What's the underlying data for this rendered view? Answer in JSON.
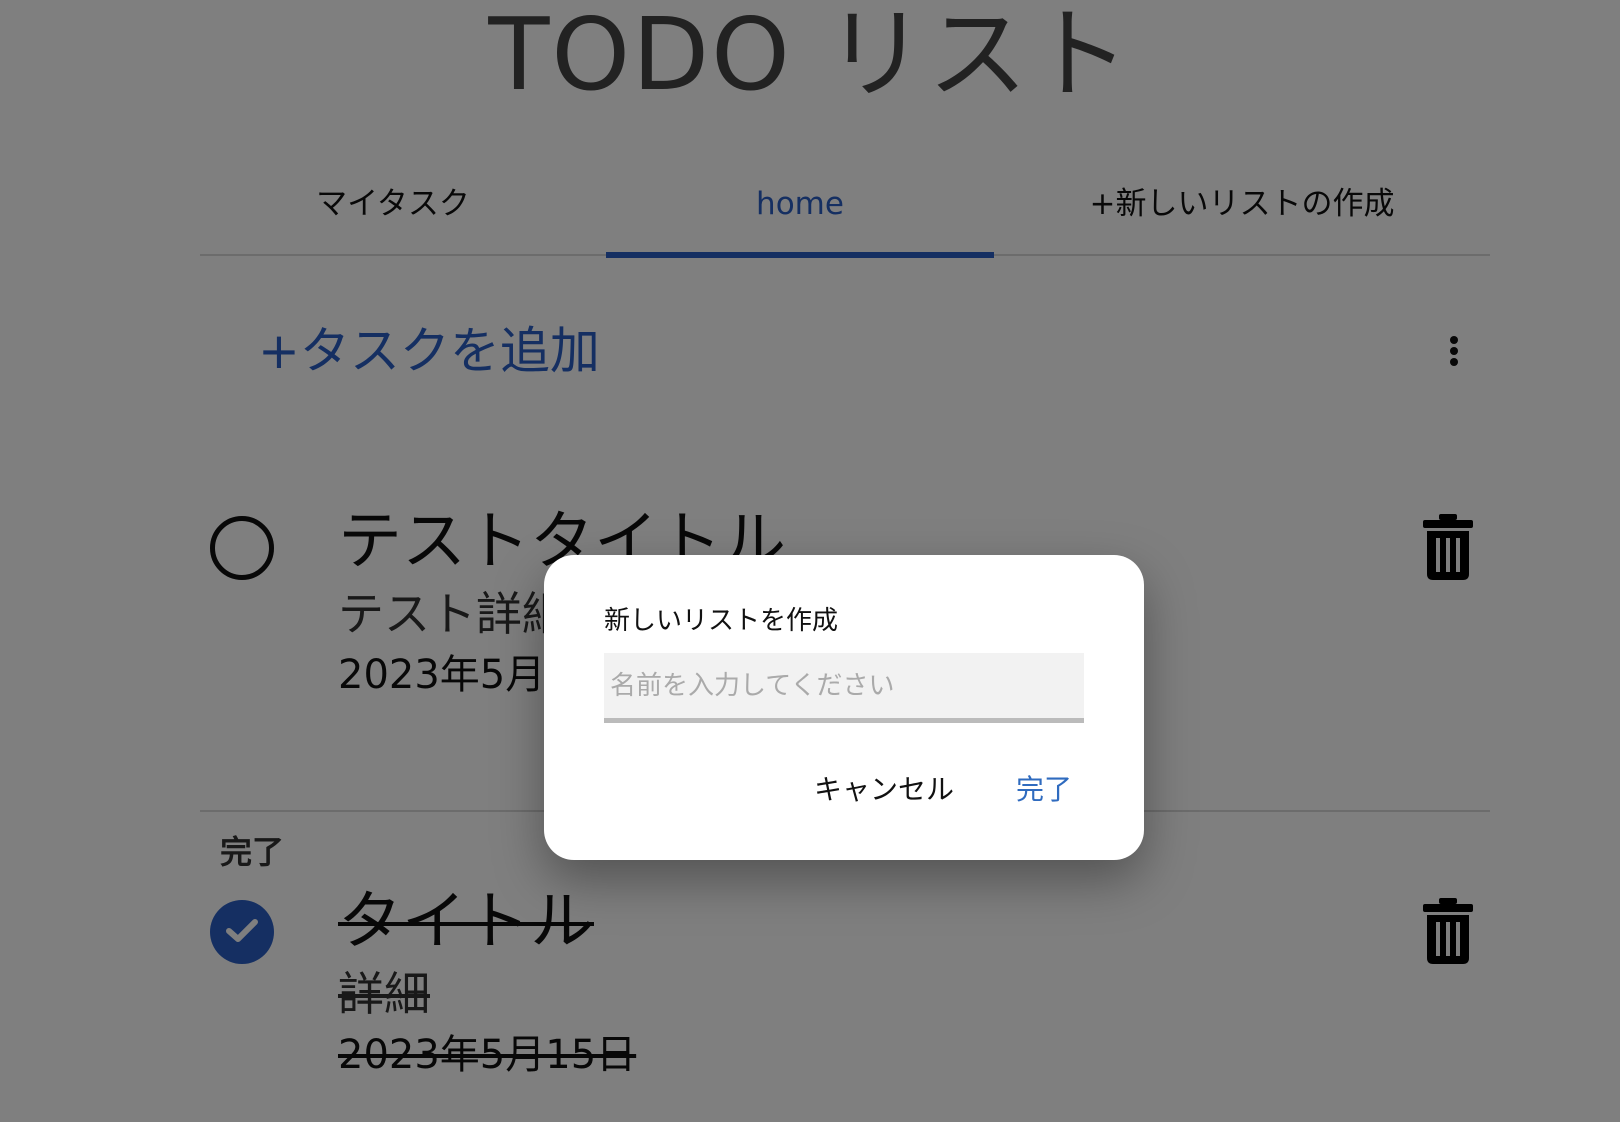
{
  "app": {
    "title": "TODO リスト"
  },
  "tabs": [
    {
      "label": "マイタスク"
    },
    {
      "label": "home",
      "active": true
    },
    {
      "label": "+新しいリストの作成"
    }
  ],
  "toolbar": {
    "add_task_label": "+タスクを追加",
    "more_icon": "more-vert-icon"
  },
  "tasks": [
    {
      "title": "テストタイトル",
      "detail": "テスト詳細",
      "date": "2023年5月",
      "completed": false
    }
  ],
  "completed_section": {
    "label": "完了",
    "tasks": [
      {
        "title": "タイトル",
        "detail": "詳細",
        "date": "2023年5月15日",
        "completed": true
      }
    ]
  },
  "dialog": {
    "title": "新しいリストを作成",
    "input": {
      "value": "",
      "placeholder": "名前を入力してください"
    },
    "cancel_label": "キャンセル",
    "done_label": "完了"
  },
  "colors": {
    "accent": "#2a5fc4",
    "scrim": "rgba(0,0,0,0.5)"
  }
}
